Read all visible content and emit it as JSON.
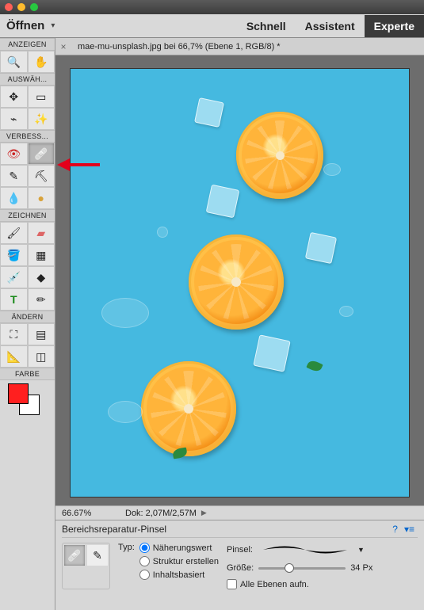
{
  "titlebar": {},
  "menu": {
    "open": "Öffnen",
    "modes": {
      "quick": "Schnell",
      "assist": "Assistent",
      "expert": "Experte"
    }
  },
  "sections": {
    "view": "ANZEIGEN",
    "select": "AUSWÄH...",
    "enhance": "VERBESS...",
    "draw": "ZEICHNEN",
    "modify": "ÄNDERN",
    "color": "FARBE"
  },
  "tools": {
    "zoom": "zoom",
    "hand": "hand",
    "move": "move",
    "marquee": "marquee",
    "lasso": "lasso",
    "wand": "magic-wand",
    "redeye": "red-eye",
    "spotheal": "spot-heal",
    "whiten": "whiten",
    "stamp": "clone-stamp",
    "blur": "blur",
    "sponge": "sponge",
    "brush": "brush",
    "eraser": "eraser",
    "bucket": "bucket",
    "gradient": "gradient",
    "picker": "color-picker",
    "shape": "shape",
    "text": "text",
    "pencil": "pencil",
    "crop": "crop",
    "recompose": "recompose",
    "straighten": "straighten",
    "transform": "transform"
  },
  "doc": {
    "tab": "mae-mu-unsplash.jpg bei 66,7% (Ebene 1, RGB/8) *",
    "zoom": "66.67%",
    "info": "Dok: 2,07M/2,57M"
  },
  "options": {
    "title": "Bereichsreparatur-Pinsel",
    "type_label": "Typ:",
    "r1": "Näherungswert",
    "r2": "Struktur erstellen",
    "r3": "Inhaltsbasiert",
    "brush_label": "Pinsel:",
    "size_label": "Größe:",
    "size_value": "34 Px",
    "all_layers": "Alle Ebenen aufn."
  },
  "colors": {
    "fg": "#ff1f1f",
    "bg": "#ffffff"
  }
}
